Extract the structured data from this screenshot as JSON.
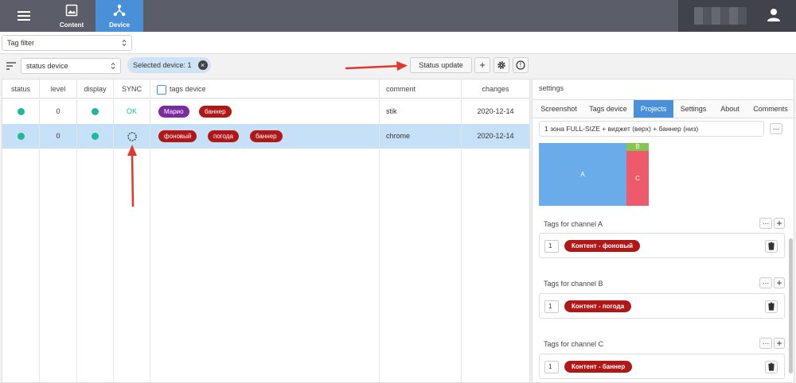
{
  "topnav": {
    "tabs": [
      {
        "label": "Content",
        "icon": "image-icon"
      },
      {
        "label": "Device",
        "icon": "network-icon",
        "active": true
      }
    ]
  },
  "filter": {
    "tag_filter": "Tag filter"
  },
  "toolbar": {
    "status_select": "status device",
    "selected_chip": "Selected device: 1",
    "status_update": "Status update",
    "add": "+",
    "info": "!"
  },
  "table": {
    "headers": [
      "status",
      "level",
      "display",
      "SYNC",
      "tags device",
      "comment",
      "changes"
    ],
    "rows": [
      {
        "level": "0",
        "sync": "OK",
        "tags": [
          "Марио",
          "баннер"
        ],
        "comment": "stik",
        "changes": "2020-12-14"
      },
      {
        "level": "0",
        "sync": "",
        "tags": [
          "фоновый",
          "погода",
          "баннер"
        ],
        "comment": "chrome",
        "changes": "2020-12-14"
      }
    ]
  },
  "settings": {
    "title": "settings",
    "tabs": [
      "Screenshot",
      "Tags device",
      "Projects",
      "Settings",
      "About",
      "Comments"
    ],
    "active_tab": "Projects",
    "project": "1 зона FULL-SIZE + виджет (верх) + баннер (низ)",
    "zones": {
      "a": "A",
      "b": "B",
      "c": "C"
    },
    "channels": [
      {
        "label": "Tags for channel A",
        "num": "1",
        "tag": "Контент - фоновый"
      },
      {
        "label": "Tags for channel B",
        "num": "1",
        "tag": "Контент - погода"
      },
      {
        "label": "Tags for channel C",
        "num": "1",
        "tag": "Контент - баннер"
      }
    ]
  },
  "colors": {
    "accent": "#4a90d9",
    "tag_red": "#b01818",
    "tag_purple": "#7b2aa0",
    "status_green": "#1eb89a",
    "annotation": "#e0392b"
  }
}
